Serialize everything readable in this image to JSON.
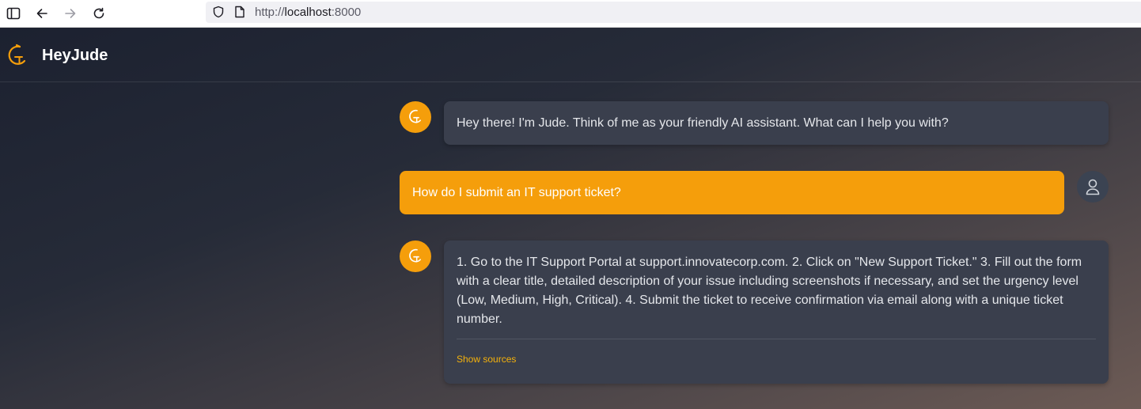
{
  "browser": {
    "url_prefix": "http://",
    "url_host": "localhost",
    "url_port": ":8000"
  },
  "app": {
    "brand_name": "HeyJude",
    "accent_color": "#f59e0b"
  },
  "messages": [
    {
      "role": "assistant",
      "text": "Hey there! I'm Jude. Think of me as your friendly AI assistant. What can I help you with?"
    },
    {
      "role": "user",
      "text": "How do I submit an IT support ticket?"
    },
    {
      "role": "assistant",
      "text": "1. Go to the IT Support Portal at support.innovatecorp.com. 2. Click on \"New Support Ticket.\" 3. Fill out the form with a clear title, detailed description of your issue including screenshots if necessary, and set the urgency level (Low, Medium, High, Critical). 4. Submit the ticket to receive confirmation via email along with a unique ticket number.",
      "sources_label": "Show sources"
    }
  ]
}
